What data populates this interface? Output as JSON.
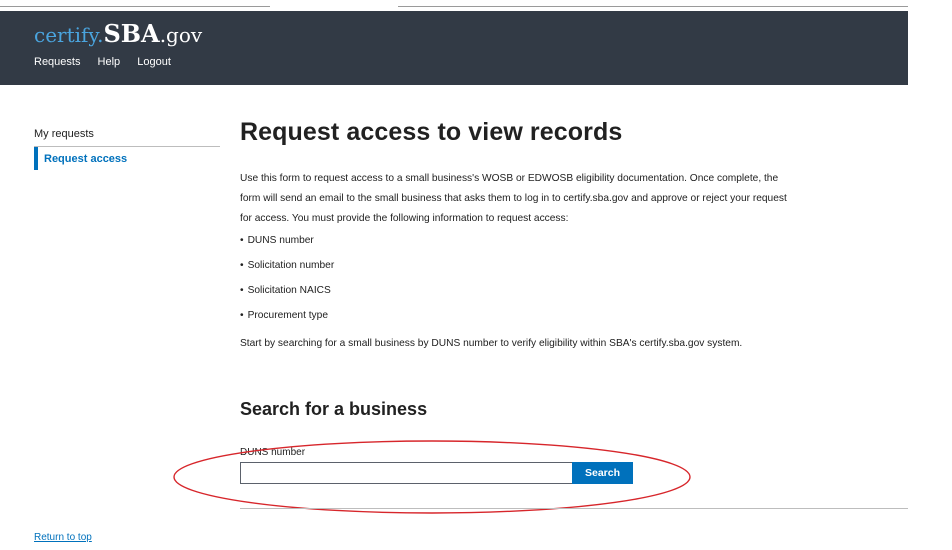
{
  "header": {
    "logo_prefix": "certify.",
    "logo_main": "SBA",
    "logo_suffix": ".gov",
    "nav": [
      "Requests",
      "Help",
      "Logout"
    ]
  },
  "sidebar": {
    "items": [
      {
        "label": "My requests",
        "active": false
      },
      {
        "label": "Request access",
        "active": true
      }
    ]
  },
  "main": {
    "title": "Request access to view records",
    "intro": "Use this form to request access to a small business's WOSB or EDWOSB eligibility documentation. Once complete, the form will send an email to the small business that asks them to log in to certify.sba.gov and approve or reject your request for access. You must provide the following information to request access:",
    "bullet_char": "•",
    "requirements": [
      "DUNS number",
      "Solicitation number",
      "Solicitation NAICS",
      "Procurement type"
    ],
    "start_text": "Start by searching for a small business by DUNS number to verify eligibility within SBA's certify.sba.gov system."
  },
  "search": {
    "heading": "Search for a business",
    "field_label": "DUNS number",
    "input_value": "",
    "button_label": "Search"
  },
  "footer": {
    "return_top": "Return to top"
  },
  "colors": {
    "header_bg": "#323a45",
    "accent": "#0071bc",
    "logo_accent": "#4aa4de",
    "annotation": "#d7262b"
  }
}
